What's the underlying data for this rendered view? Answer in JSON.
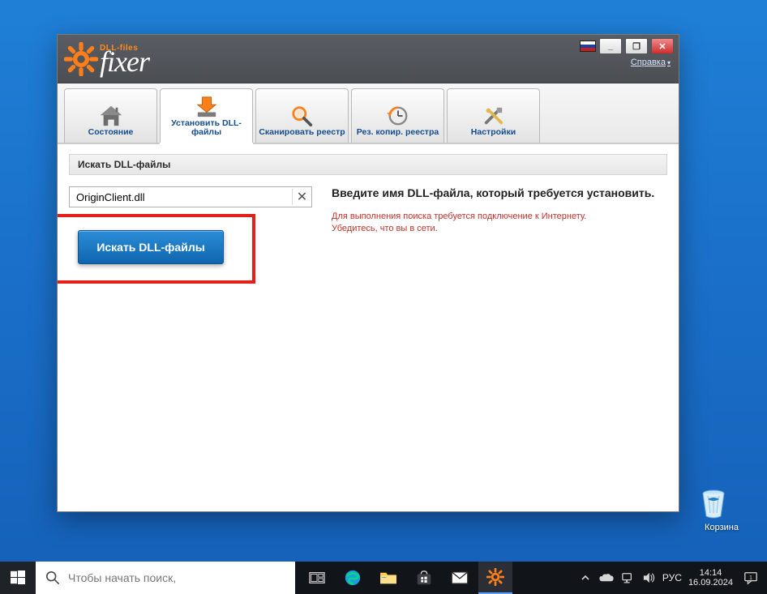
{
  "colors": {
    "accent": "#ff7f1a",
    "primary": "#0f66af",
    "danger": "#c0322b",
    "highlight_border": "#e1201c"
  },
  "brand": {
    "sub": "DLL-files",
    "main": "fixer"
  },
  "window_controls": {
    "min": "_",
    "max": "❐",
    "close": "✕"
  },
  "header": {
    "help": "Справка",
    "help_arrow": "▾"
  },
  "tabs": [
    {
      "label": "Состояние"
    },
    {
      "label": "Установить DLL-файлы"
    },
    {
      "label": "Сканировать реестр"
    },
    {
      "label": "Рез. копир. реестра"
    },
    {
      "label": "Настройки"
    }
  ],
  "section_title": "Искать DLL-файлы",
  "search": {
    "value": "OriginClient.dll",
    "placeholder": "",
    "clear": "✕"
  },
  "search_button": "Искать DLL-файлы",
  "instructions": {
    "title": "Введите имя DLL-файла, который требуется установить.",
    "line1": "Для выполнения поиска требуется подключение к Интернету.",
    "line2": "Убедитесь, что вы в сети."
  },
  "desktop_icon": {
    "label": "Корзина"
  },
  "taskbar": {
    "search_placeholder": "Чтобы начать поиск,",
    "lang": "РУС",
    "time": "14:14",
    "date": "16.09.2024"
  }
}
